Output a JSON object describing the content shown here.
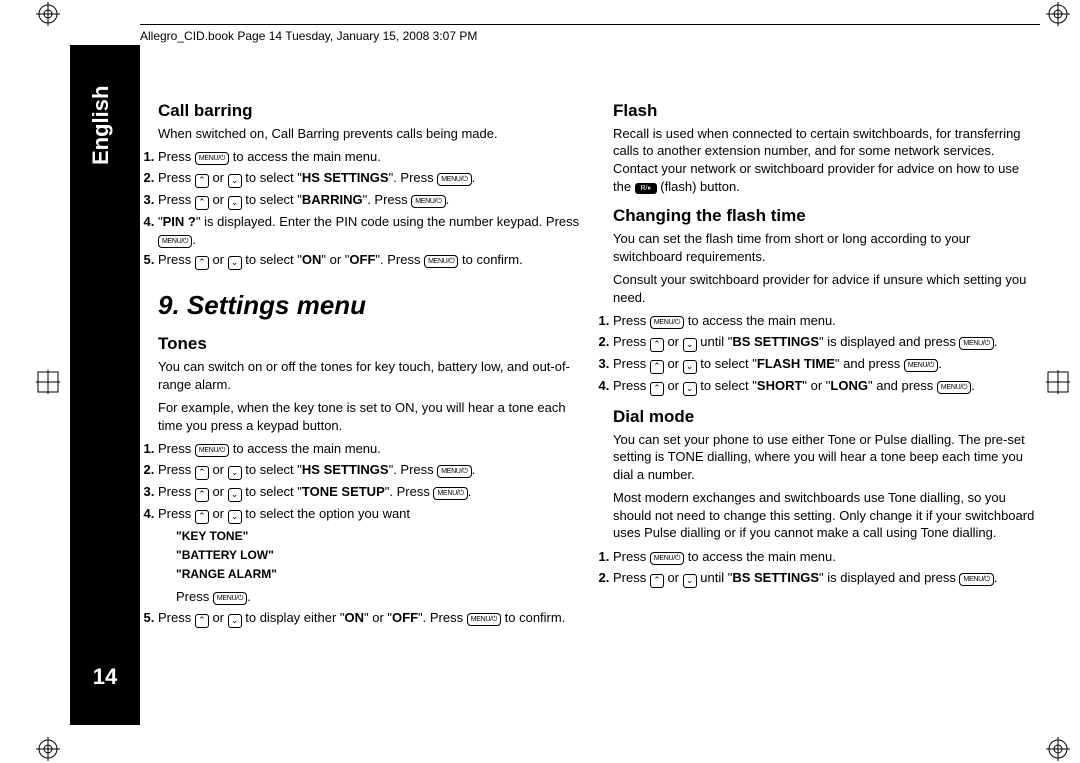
{
  "header": "Allegro_CID.book  Page 14  Tuesday, January 15, 2008  3:07 PM",
  "language": "English",
  "pageNumber": "14",
  "keys": {
    "menu": "MENU/⏻",
    "up": "⌃",
    "down": "⌄",
    "flash": "R/⏸"
  },
  "left": {
    "callBarring": {
      "title": "Call barring",
      "intro": "When switched on, Call Barring prevents calls being made.",
      "s1a": "Press ",
      "s1b": " to access the main menu.",
      "s2a": "Press ",
      "s2b": " or ",
      "s2c": " to select \"",
      "s2d": "HS SETTINGS",
      "s2e": "\". Press ",
      "s2f": ".",
      "s3a": "Press ",
      "s3b": " or ",
      "s3c": " to select \"",
      "s3d": "BARRING",
      "s3e": "\". Press ",
      "s3f": ".",
      "s4a": "\"",
      "s4b": "PIN ?",
      "s4c": "\" is displayed. Enter the PIN code using the number keypad. Press ",
      "s4d": ".",
      "s5a": "Press ",
      "s5b": " or ",
      "s5c": " to select \"",
      "s5d": "ON",
      "s5e": "\" or \"",
      "s5f": "OFF",
      "s5g": "\". Press ",
      "s5h": " to confirm."
    },
    "chapter": "9. Settings menu",
    "tones": {
      "title": "Tones",
      "p1": "You can switch on or off the tones for key touch, battery low, and out-of-range alarm.",
      "p2": "For example, when the key tone is set to ON, you will hear a tone each time you press a keypad button.",
      "s1a": "Press ",
      "s1b": " to access the main menu.",
      "s2a": "Press ",
      "s2b": " or ",
      "s2c": " to select \"",
      "s2d": "HS SETTINGS",
      "s2e": "\". Press ",
      "s2f": ".",
      "s3a": "Press ",
      "s3b": " or ",
      "s3c": " to select \"",
      "s3d": "TONE SETUP",
      "s3e": "\". Press ",
      "s3f": ".",
      "s4a": "Press ",
      "s4b": " or ",
      "s4c": " to select the option you want",
      "opt1": "\"KEY TONE\"",
      "opt2": "\"BATTERY LOW\"",
      "opt3": "\"RANGE ALARM\"",
      "afterA": "Press ",
      "afterB": ".",
      "s5a": "Press ",
      "s5b": " or ",
      "s5c": " to display either \"",
      "s5d": "ON",
      "s5e": "\" or \"",
      "s5f": "OFF",
      "s5g": "\". Press ",
      "s5h": " to confirm."
    }
  },
  "right": {
    "flash": {
      "title": "Flash",
      "p1a": "Recall is used when connected to certain switchboards, for transferring calls to another extension number, and for some network services. Contact your network or switchboard provider for advice on how to use the ",
      "p1b": " (flash) button."
    },
    "changing": {
      "title": "Changing the flash time",
      "p1": "You can set the flash time from short or long according to your switchboard requirements.",
      "p2": "Consult your switchboard provider for advice if unsure which setting you need.",
      "s1a": "Press ",
      "s1b": " to access the main menu.",
      "s2a": "Press ",
      "s2b": " or ",
      "s2c": " until \"",
      "s2d": "BS SETTINGS",
      "s2e": "\" is displayed and press ",
      "s2f": ".",
      "s3a": "Press ",
      "s3b": " or ",
      "s3c": " to select \"",
      "s3d": "FLASH TIME",
      "s3e": "\" and press ",
      "s3f": ".",
      "s4a": "Press ",
      "s4b": " or ",
      "s4c": " to select \"",
      "s4d": "SHORT",
      "s4e": "\" or \"",
      "s4f": "LONG",
      "s4g": "\" and press ",
      "s4h": "."
    },
    "dial": {
      "title": "Dial mode",
      "p1": "You can set your phone to use either Tone or Pulse dialling. The pre-set setting is TONE dialling, where you will hear a tone beep each time you dial a number.",
      "p2": "Most modern exchanges and switchboards use Tone dialling, so you should not need to change this setting. Only change it if your switchboard uses Pulse dialling or if you cannot make a call using Tone dialling.",
      "s1a": "Press ",
      "s1b": " to access the main menu.",
      "s2a": "Press ",
      "s2b": " or ",
      "s2c": " until \"",
      "s2d": "BS SETTINGS",
      "s2e": "\" is displayed and press ",
      "s2f": "."
    }
  }
}
